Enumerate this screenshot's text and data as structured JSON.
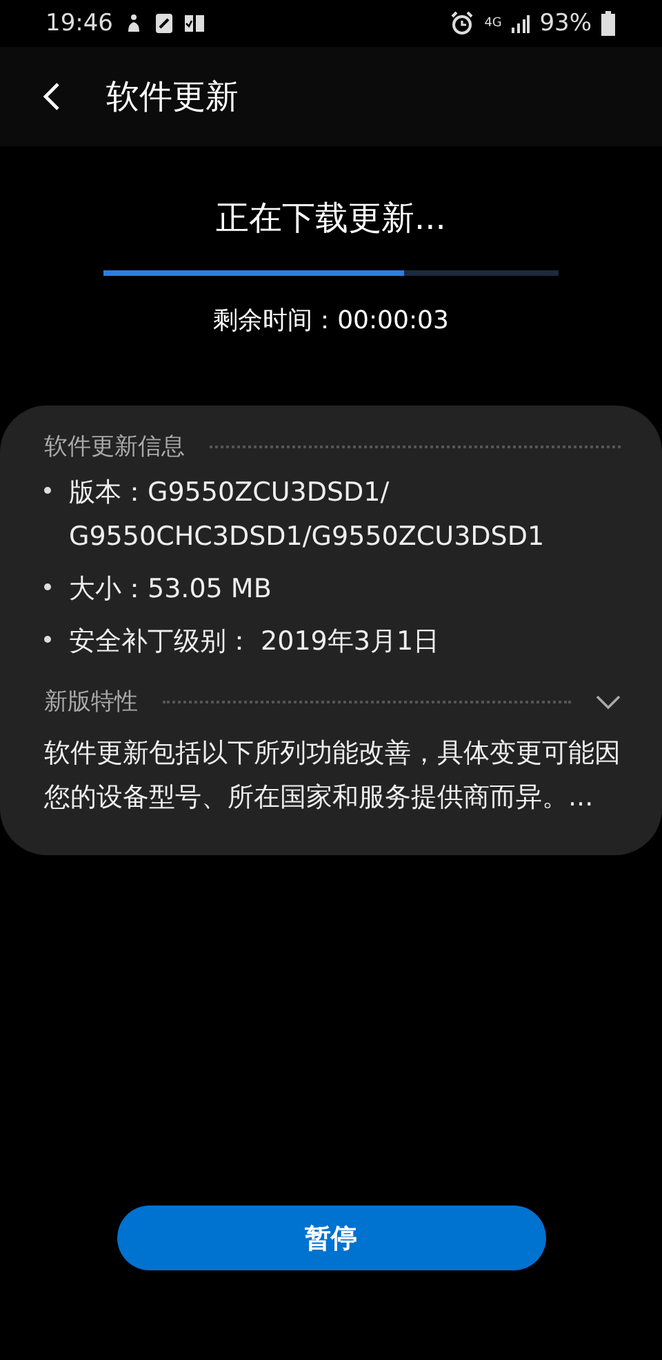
{
  "status_bar": {
    "time": "19:46",
    "network_type": "4G",
    "battery": "93%"
  },
  "header": {
    "title": "软件更新"
  },
  "download": {
    "title": "正在下载更新...",
    "level": 0.66,
    "remaining": "剩余时间：00:00:03"
  },
  "info_card": {
    "heading": "软件更新信息",
    "items": [
      {
        "label": "版本：",
        "value": "G9550ZCU3DSD1/\nG9550CHC3DSD1/G9550ZCU3DSD1"
      },
      {
        "label": "大小：",
        "value": "53.05 MB"
      },
      {
        "label": "安全补丁级别：",
        "value": " 2019年3月1日"
      }
    ],
    "features": {
      "heading": "新版特性",
      "expanded": false,
      "text": "软件更新包括以下所列功能改善，具体变更可能因您的设备型号、所在国家和服务提供商而异。..."
    }
  },
  "button": {
    "label": "暂停"
  }
}
